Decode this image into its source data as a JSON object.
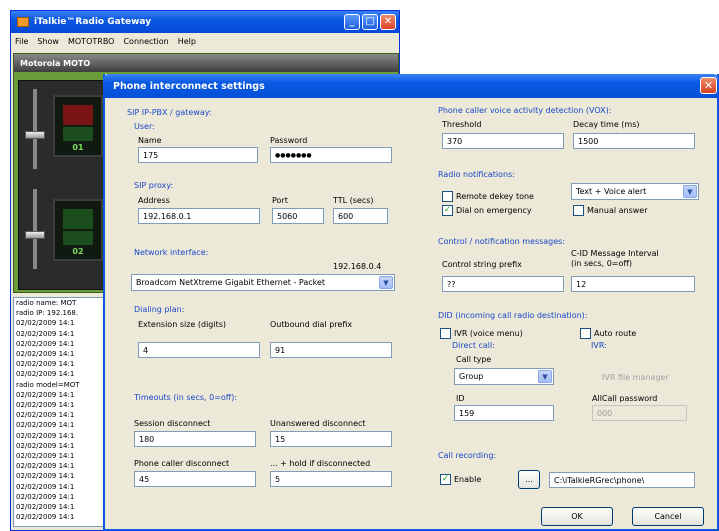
{
  "main_window": {
    "title": "iTalkie™Radio Gateway",
    "menu": [
      "File",
      "Show",
      "MOTOTRBO",
      "Connection",
      "Help"
    ],
    "device_title": "Motorola MOTO",
    "channel_labels": [
      "01",
      "02"
    ],
    "log_lines": [
      "radio name: MOT",
      "radio IP: 192.168.",
      "02/02/2009 14:1",
      "02/02/2009 14:1",
      "02/02/2009 14:1",
      "02/02/2009 14:1",
      "02/02/2009 14:1",
      "02/02/2009 14:1",
      "radio model=MOT",
      "02/02/2009 14:1",
      "02/02/2009 14:1",
      "02/02/2009 14:1",
      "02/02/2009 14:1",
      "02/02/2009 14:1",
      "02/02/2009 14:1",
      "02/02/2009 14:1",
      "02/02/2009 14:1",
      "02/02/2009 14:1",
      "02/02/2009 14:1",
      "02/02/2009 14:1",
      "02/02/2009 14:1",
      "02/02/2009 14:1"
    ]
  },
  "dialog": {
    "title": "Phone interconnect settings",
    "sip": {
      "section": "SIP IP-PBX / gateway:",
      "user_label": "User:",
      "name_label": "Name",
      "name_value": "175",
      "password_label": "Password",
      "password_value": "●●●●●●●",
      "proxy_label": "SIP proxy:",
      "address_label": "Address",
      "address_value": "192.168.0.1",
      "port_label": "Port",
      "port_value": "5060",
      "ttl_label": "TTL (secs)",
      "ttl_value": "600"
    },
    "network": {
      "section": "Network interface:",
      "ip": "192.168.0.4",
      "adapter": "Broadcom NetXtreme Gigabit Ethernet - Packet"
    },
    "dialing": {
      "section": "Dialing plan:",
      "ext_size_label": "Extension size (digits)",
      "ext_size_value": "4",
      "outbound_label": "Outbound dial prefix",
      "outbound_value": "91"
    },
    "timeouts": {
      "section": "Timeouts (in secs, 0=off):",
      "session_label": "Session disconnect",
      "session_value": "180",
      "unanswered_label": "Unanswered disconnect",
      "unanswered_value": "15",
      "caller_label": "Phone caller disconnect",
      "caller_value": "45",
      "hold_label": "... + hold if disconnected",
      "hold_value": "5"
    },
    "vox": {
      "section": "Phone caller voice activity detection (VOX):",
      "threshold_label": "Threshold",
      "threshold_value": "370",
      "decay_label": "Decay time (ms)",
      "decay_value": "1500"
    },
    "radio_notifications": {
      "section": "Radio notifications:",
      "remote_dekey": "Remote dekey tone",
      "remote_dekey_checked": false,
      "dial_emergency": "Dial on emergency",
      "dial_emergency_checked": true,
      "alert_mode": "Text + Voice alert",
      "manual_answer": "Manual answer",
      "manual_answer_checked": false
    },
    "control": {
      "section": "Control / notification messages:",
      "prefix_label": "Control string prefix",
      "prefix_value": "??",
      "interval_label_1": "C-ID Message Interval",
      "interval_label_2": "(in secs, 0=off)",
      "interval_value": "12"
    },
    "did": {
      "section": "DID (incoming call radio destination):",
      "ivr_label": "IVR (voice menu)",
      "ivr_checked": false,
      "auto_route_label": "Auto route",
      "auto_route_checked": false,
      "direct_call_label": "Direct call:",
      "ivr_sub_label": "IVR:",
      "call_type_label": "Call type",
      "call_type_value": "Group",
      "id_label": "ID",
      "id_value": "159",
      "ivr_file_button": "IVR file manager",
      "allcall_label": "AllCall password",
      "allcall_value": "000"
    },
    "recording": {
      "section": "Call recording:",
      "enable_label": "Enable",
      "enable_checked": true,
      "browse_label": "...",
      "path": "C:\\iTalkieRGrec\\phone\\"
    },
    "ok_label": "OK",
    "cancel_label": "Cancel"
  }
}
